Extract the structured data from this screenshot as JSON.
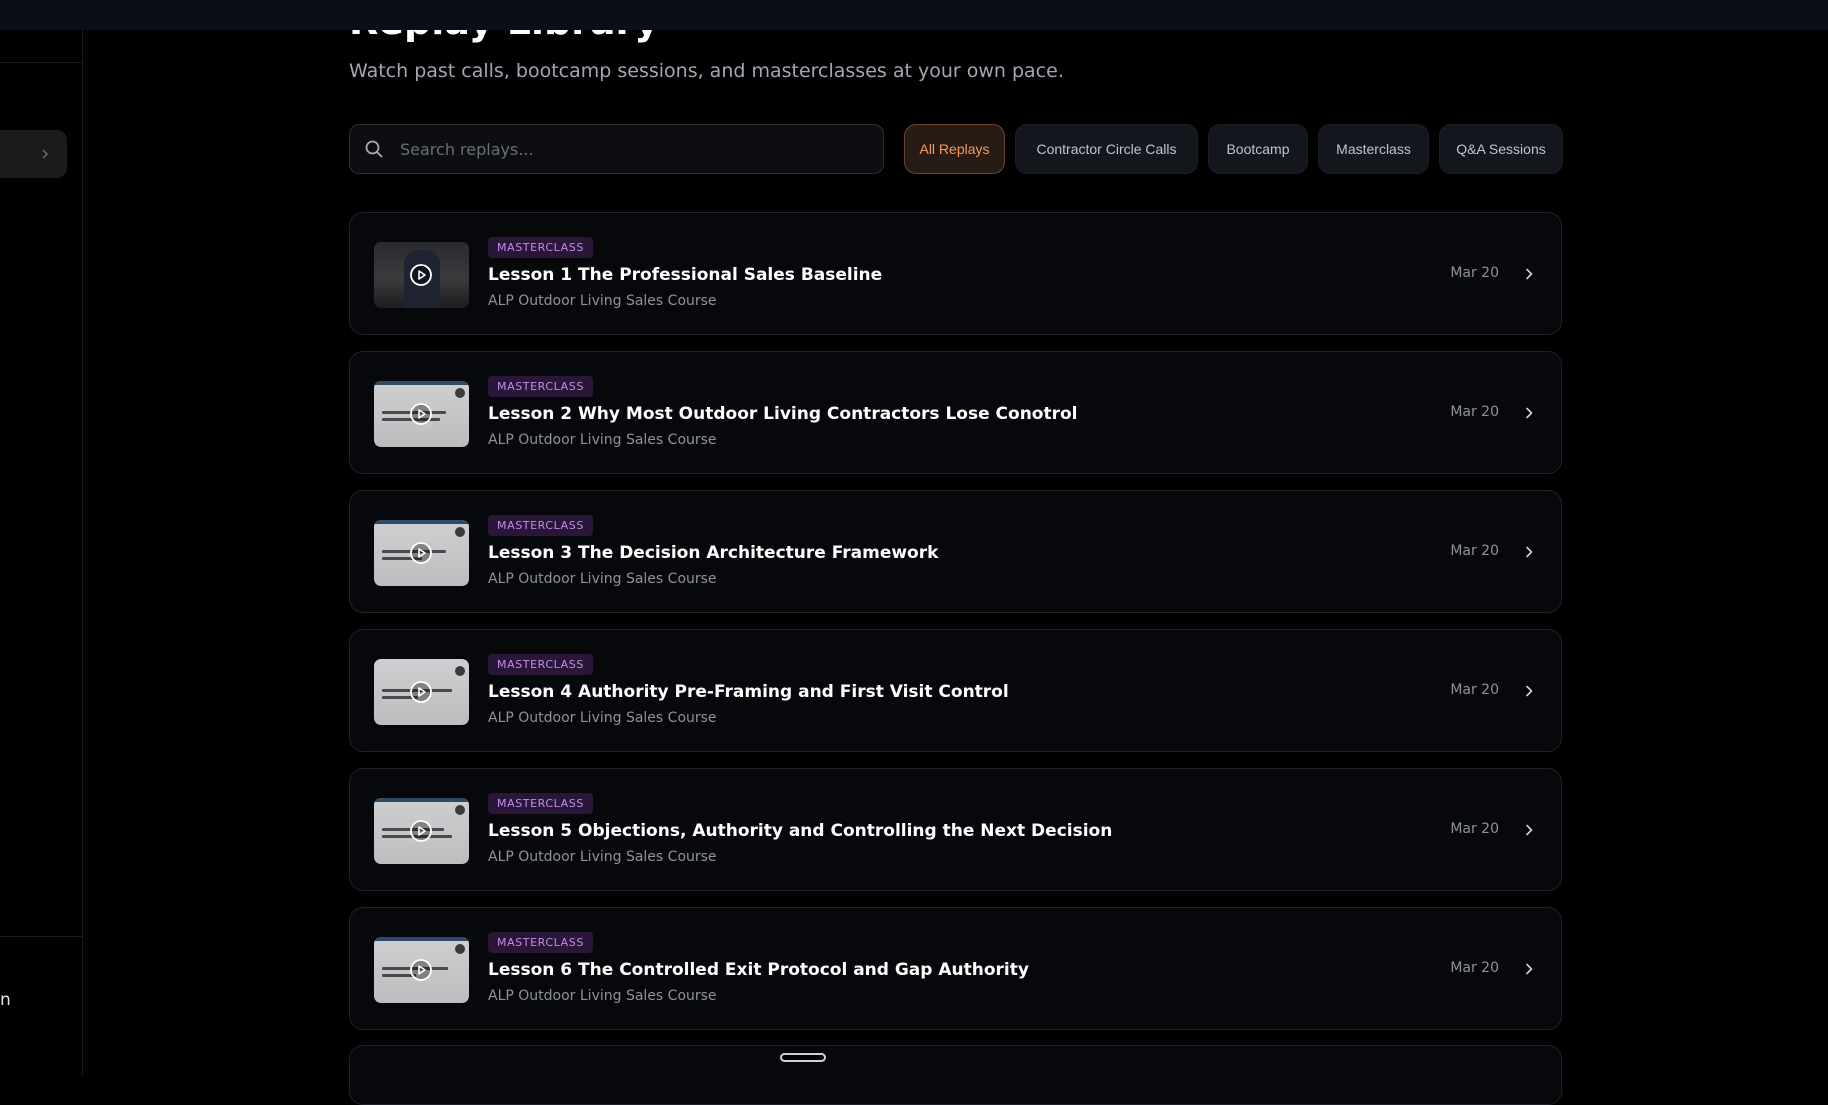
{
  "header": {
    "title": "Replay Library",
    "subtitle": "Watch past calls, bootcamp sessions, and masterclasses at your own pace."
  },
  "sidebar": {
    "partial_label": "n"
  },
  "search": {
    "placeholder": "Search replays...",
    "value": ""
  },
  "filters": [
    {
      "label": "All Replays",
      "active": true
    },
    {
      "label": "Contractor Circle Calls",
      "active": false
    },
    {
      "label": "Bootcamp",
      "active": false
    },
    {
      "label": "Masterclass",
      "active": false
    },
    {
      "label": "Q&A Sessions",
      "active": false
    }
  ],
  "replays": [
    {
      "badge": "MASTERCLASS",
      "title": "Lesson 1 The Professional Sales Baseline",
      "course": "ALP Outdoor Living Sales Course",
      "date": "Mar 20"
    },
    {
      "badge": "MASTERCLASS",
      "title": "Lesson 2 Why Most Outdoor Living Contractors Lose Conotrol",
      "course": "ALP Outdoor Living Sales Course",
      "date": "Mar 20"
    },
    {
      "badge": "MASTERCLASS",
      "title": "Lesson 3 The Decision Architecture Framework",
      "course": "ALP Outdoor Living Sales Course",
      "date": "Mar 20"
    },
    {
      "badge": "MASTERCLASS",
      "title": "Lesson 4 Authority Pre-Framing and First Visit Control",
      "course": "ALP Outdoor Living Sales Course",
      "date": "Mar 20"
    },
    {
      "badge": "MASTERCLASS",
      "title": "Lesson 5 Objections, Authority and Controlling the Next Decision",
      "course": "ALP Outdoor Living Sales Course",
      "date": "Mar 20"
    },
    {
      "badge": "MASTERCLASS",
      "title": "Lesson 6 The Controlled Exit Protocol and Gap Authority",
      "course": "ALP Outdoor Living Sales Course",
      "date": "Mar 20"
    }
  ],
  "icons": {
    "search": "search-icon",
    "play": "play-circle-icon",
    "chevron": "chevron-right-icon"
  },
  "colors": {
    "background": "#000000",
    "accent": "#f59a5f",
    "badge_text": "#c38cf0",
    "badge_bg": "#2a1636"
  }
}
